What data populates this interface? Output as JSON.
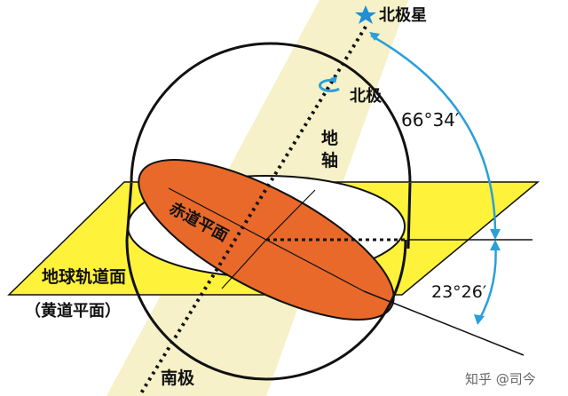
{
  "diagram": {
    "labels": {
      "polaris": "北极星",
      "north_pole": "北极",
      "earth_axis_char1": "地",
      "earth_axis_char2": "轴",
      "equatorial_plane": "赤道平面",
      "orbital_plane": "地球轨道面",
      "ecliptic_plane": "（黄道平面）",
      "south_pole": "南极",
      "angle_axis": "66°34′",
      "angle_tilt": "23°26′"
    },
    "watermark": "知乎 @司今",
    "colors": {
      "ray_background": "#f6f1c8",
      "orbital_plane": "#fff23a",
      "equatorial_disc": "#e8692a",
      "equatorial_edge": "#b5451b",
      "outline": "#111111",
      "angle_arc": "#2a9fd8",
      "star": "#1f8fd6",
      "watermark_text": "#666666"
    }
  }
}
